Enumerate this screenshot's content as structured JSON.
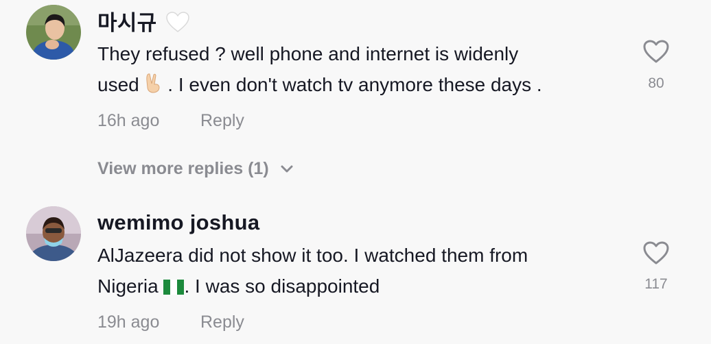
{
  "comments": [
    {
      "username": "마시규",
      "name_badge_icon": "white-heart-icon",
      "text_line1": "They refused ? well phone and internet is widenly",
      "text_line2_pre": "used ",
      "text_line2_emoji": "victory-hand-icon",
      "text_line2_post": " . I even don't watch tv anymore these days .",
      "time": "16h ago",
      "reply_label": "Reply",
      "like_count": "80",
      "view_more_label": "View more replies (1)"
    },
    {
      "username": "wemimo joshua",
      "text_line1": "AlJazeera did not show it too. I watched them from",
      "text_line2_pre": "Nigeria ",
      "text_line2_emoji": "nigeria-flag-icon",
      "text_line2_post": ". I was so disappointed",
      "time": "19h ago",
      "reply_label": "Reply",
      "like_count": "117"
    }
  ],
  "colors": {
    "background": "#f8f8f8",
    "text": "#161823",
    "secondary": "#8a8b91"
  }
}
